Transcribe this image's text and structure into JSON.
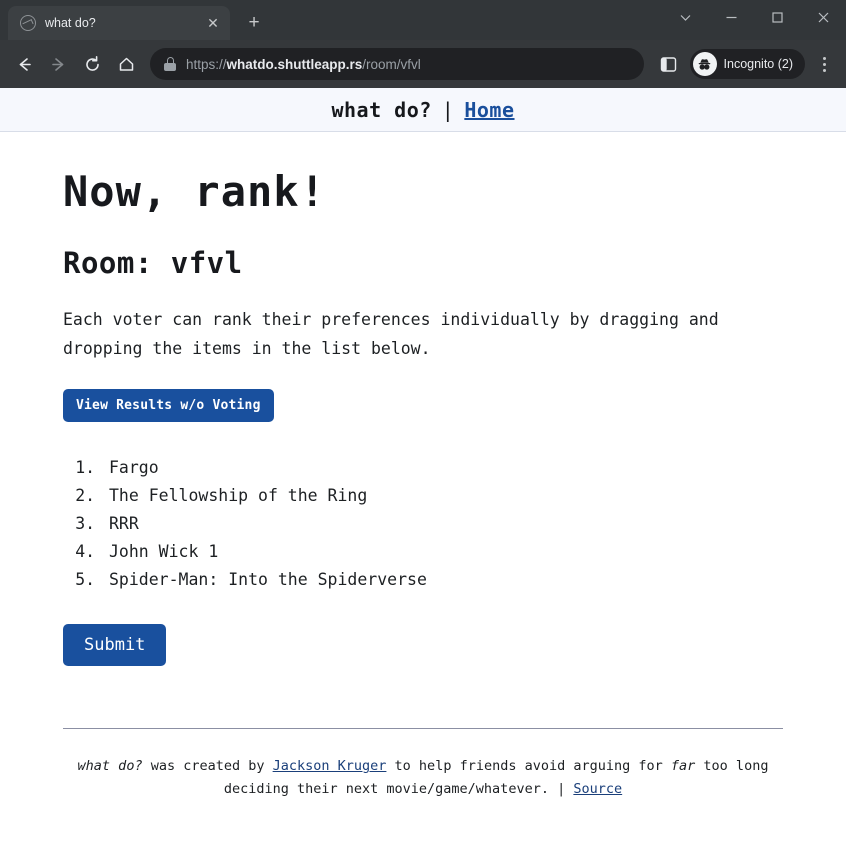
{
  "browser": {
    "tab": {
      "title": "what do?",
      "favicon": "globe-icon",
      "close_label": "✕"
    },
    "new_tab_label": "+",
    "window_controls": {
      "tab_search": "tab-search-chevron-icon",
      "minimize": "minimize-icon",
      "maximize": "maximize-icon",
      "close": "close-icon"
    },
    "toolbar": {
      "back": "back-arrow-icon",
      "forward": "forward-arrow-icon",
      "reload": "reload-icon",
      "home": "home-icon",
      "lock": "lock-icon",
      "side_panel": "side-panel-icon",
      "menu": "three-dot-menu-icon",
      "url_scheme": "https://",
      "url_host": "whatdo.shuttleapp.rs",
      "url_path": "/room/vfvl",
      "url_full": "https://whatdo.shuttleapp.rs/room/vfvl",
      "incognito_label": "Incognito (2)",
      "incognito_icon": "incognito-spy-icon"
    }
  },
  "page": {
    "header": {
      "brand": "what do?",
      "divider": "|",
      "home_link": "Home"
    },
    "title": "Now, rank!",
    "room_heading": "Room: vfvl",
    "description": "Each voter can rank their preferences individually by dragging and dropping the items in the list below.",
    "view_results_button": "View Results w/o Voting",
    "ranked_items": [
      "Fargo",
      "The Fellowship of the Ring",
      "RRR",
      "John Wick 1",
      "Spider-Man: Into the Spiderverse"
    ],
    "submit_button": "Submit",
    "footer": {
      "brand_italic": "what do?",
      "text_1": " was created by ",
      "author_link": "Jackson Kruger",
      "text_2": " to help friends avoid arguing for ",
      "emphasis": "far",
      "text_3": " too long deciding their next movie/game/whatever. ",
      "separator": "|",
      "source_link": "Source"
    }
  },
  "colors": {
    "accent_blue": "#19509e",
    "link_blue": "#1a4f9c",
    "chrome_tabstrip": "#323639",
    "chrome_toolbar": "#35383b",
    "omnibox": "#202124",
    "site_header_bg": "#f6f8fd"
  }
}
